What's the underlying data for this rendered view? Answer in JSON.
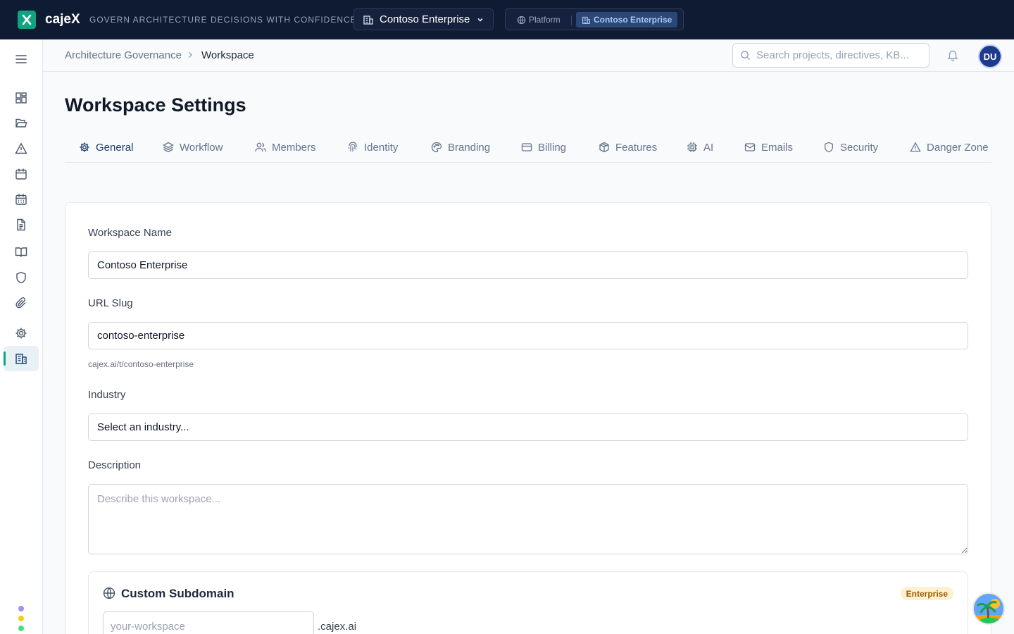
{
  "app": {
    "name": "cajeX",
    "tagline": "GOVERN ARCHITECTURE DECISIONS WITH CONFIDENCE",
    "workspace_selector": "Contoso Enterprise",
    "context_switch": {
      "platform": "Platform",
      "active": "Contoso Enterprise"
    },
    "brand_color": "#10a37f"
  },
  "sidebar": {
    "items": [
      {
        "icon": "menu-icon"
      },
      {
        "icon": "dashboard-icon"
      },
      {
        "icon": "folder-icon"
      },
      {
        "icon": "warning-icon"
      },
      {
        "icon": "calendar-icon"
      },
      {
        "icon": "calendar-grid-icon"
      },
      {
        "icon": "document-icon"
      },
      {
        "icon": "book-icon"
      },
      {
        "icon": "shield-icon"
      },
      {
        "icon": "paperclip-icon"
      },
      {
        "icon": "gear-icon"
      },
      {
        "icon": "building-icon",
        "active": true
      }
    ],
    "dot_colors": [
      "#a78bfa",
      "#facc15",
      "#4ade80"
    ]
  },
  "header": {
    "breadcrumb": {
      "root": "Architecture Governance",
      "current": "Workspace"
    },
    "search": {
      "placeholder": "Search projects, directives, KB..."
    },
    "avatar_initials": "DU"
  },
  "page": {
    "title": "Workspace Settings",
    "tabs": [
      {
        "label": "General",
        "icon": "gear-icon",
        "active": true
      },
      {
        "label": "Workflow",
        "icon": "layers-icon"
      },
      {
        "label": "Members",
        "icon": "users-icon"
      },
      {
        "label": "Identity",
        "icon": "fingerprint-icon"
      },
      {
        "label": "Branding",
        "icon": "palette-icon"
      },
      {
        "label": "Billing",
        "icon": "credit-card-icon"
      },
      {
        "label": "Features",
        "icon": "box-icon"
      },
      {
        "label": "AI",
        "icon": "chip-icon"
      },
      {
        "label": "Emails",
        "icon": "mail-icon"
      },
      {
        "label": "Security",
        "icon": "shield-icon"
      },
      {
        "label": "Danger Zone",
        "icon": "warning-icon"
      }
    ]
  },
  "form": {
    "workspace_name": {
      "label": "Workspace Name",
      "value": "Contoso Enterprise"
    },
    "url_slug": {
      "label": "URL Slug",
      "value": "contoso-enterprise",
      "hint": "cajex.ai/t/contoso-enterprise"
    },
    "industry": {
      "label": "Industry",
      "value": "Select an industry..."
    },
    "description": {
      "label": "Description",
      "placeholder": "Describe this workspace..."
    },
    "custom_subdomain": {
      "title": "Custom Subdomain",
      "badge": "Enterprise",
      "placeholder": "your-workspace",
      "suffix": ".cajex.ai"
    }
  }
}
